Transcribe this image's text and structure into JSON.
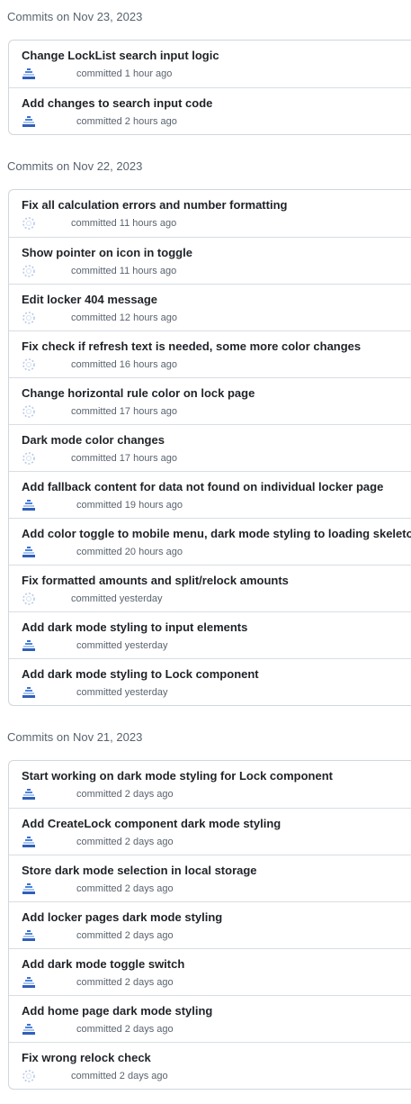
{
  "groups": [
    {
      "header": "Commits on Nov 23, 2023",
      "commits": [
        {
          "title": "Change LockList search input logic",
          "byline": "committed 1 hour ago",
          "avatar": "blue"
        },
        {
          "title": "Add changes to search input code",
          "byline": "committed 2 hours ago",
          "avatar": "blue"
        }
      ]
    },
    {
      "header": "Commits on Nov 22, 2023",
      "commits": [
        {
          "title": "Fix all calculation errors and number formatting",
          "byline": "committed 11 hours ago",
          "avatar": "dots"
        },
        {
          "title": "Show pointer on icon in toggle",
          "byline": "committed 11 hours ago",
          "avatar": "dots"
        },
        {
          "title": "Edit locker 404 message",
          "byline": "committed 12 hours ago",
          "avatar": "dots"
        },
        {
          "title": "Fix check if refresh text is needed, some more color changes",
          "byline": "committed 16 hours ago",
          "avatar": "dots"
        },
        {
          "title": "Change horizontal rule color on lock page",
          "byline": "committed 17 hours ago",
          "avatar": "dots"
        },
        {
          "title": "Dark mode color changes",
          "byline": "committed 17 hours ago",
          "avatar": "dots"
        },
        {
          "title": "Add fallback content for data not found on individual locker page",
          "byline": "committed 19 hours ago",
          "avatar": "blue"
        },
        {
          "title": "Add color toggle to mobile menu, dark mode styling to loading skeletons",
          "byline": "committed 20 hours ago",
          "avatar": "blue"
        },
        {
          "title": "Fix formatted amounts and split/relock amounts",
          "byline": "committed yesterday",
          "avatar": "dots"
        },
        {
          "title": "Add dark mode styling to input elements",
          "byline": "committed yesterday",
          "avatar": "blue"
        },
        {
          "title": "Add dark mode styling to Lock component",
          "byline": "committed yesterday",
          "avatar": "blue"
        }
      ]
    },
    {
      "header": "Commits on Nov 21, 2023",
      "commits": [
        {
          "title": "Start working on dark mode styling for Lock component",
          "byline": "committed 2 days ago",
          "avatar": "blue"
        },
        {
          "title": "Add CreateLock component dark mode styling",
          "byline": "committed 2 days ago",
          "avatar": "blue"
        },
        {
          "title": "Store dark mode selection in local storage",
          "byline": "committed 2 days ago",
          "avatar": "blue"
        },
        {
          "title": "Add locker pages dark mode styling",
          "byline": "committed 2 days ago",
          "avatar": "blue"
        },
        {
          "title": "Add dark mode toggle switch",
          "byline": "committed 2 days ago",
          "avatar": "blue"
        },
        {
          "title": "Add home page dark mode styling",
          "byline": "committed 2 days ago",
          "avatar": "blue"
        },
        {
          "title": "Fix wrong relock check",
          "byline": "committed 2 days ago",
          "avatar": "dots"
        }
      ]
    }
  ]
}
